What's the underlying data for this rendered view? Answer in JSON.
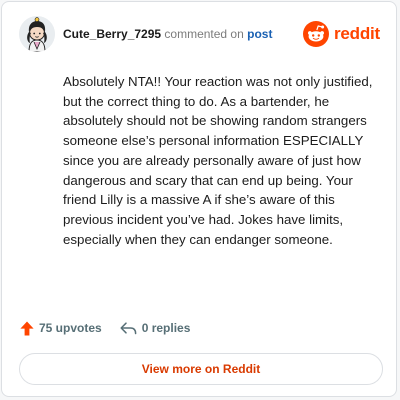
{
  "comment": {
    "username": "Cute_Berry_7295",
    "action_text": "commented on",
    "post_link_label": "post",
    "body": "Absolutely NTA!! Your reaction was not only justified, but the correct thing to do. As a bartender, he absolutely should not be showing random strangers someone else’s personal information ESPECIALLY since you are already personally aware of just how dangerous and scary that can end up being. Your friend Lilly is a massive A if she’s aware of this previous incident you’ve had. Jokes have limits, especially when they can endanger someone."
  },
  "brand": {
    "name": "reddit",
    "icon": "reddit-logo-icon",
    "color": "#ff4500"
  },
  "stats": {
    "upvotes_label": "75 upvotes",
    "replies_label": "0 replies",
    "upvote_icon": "upvote-arrow-icon",
    "reply_icon": "reply-arrow-icon",
    "upvote_color": "#ff4500"
  },
  "cta": {
    "label": "View more on Reddit",
    "color": "#d93a00"
  }
}
